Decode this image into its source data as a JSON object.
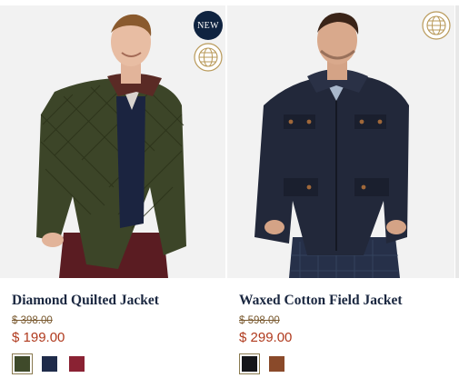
{
  "badges": {
    "new_label": "NEW"
  },
  "icons": {
    "shipping": "globe-icon"
  },
  "products": [
    {
      "name": "Diamond Quilted Jacket",
      "original_price": "$ 398.00",
      "sale_price": "$ 199.00",
      "swatches": [
        {
          "color": "olive",
          "hex": "#3f4a2a",
          "selected": true
        },
        {
          "color": "navy",
          "hex": "#1f2b4a",
          "selected": false
        },
        {
          "color": "burgundy",
          "hex": "#8a2233",
          "selected": false
        }
      ]
    },
    {
      "name": "Waxed Cotton Field Jacket",
      "original_price": "$ 598.00",
      "sale_price": "$ 299.00",
      "swatches": [
        {
          "color": "black",
          "hex": "#15161a",
          "selected": true
        },
        {
          "color": "brown",
          "hex": "#8a4a2a",
          "selected": false
        }
      ]
    }
  ],
  "colors": {
    "accent_gold": "#b99a5a",
    "sale_red": "#b03a1e",
    "badge_navy": "#0f2340"
  }
}
